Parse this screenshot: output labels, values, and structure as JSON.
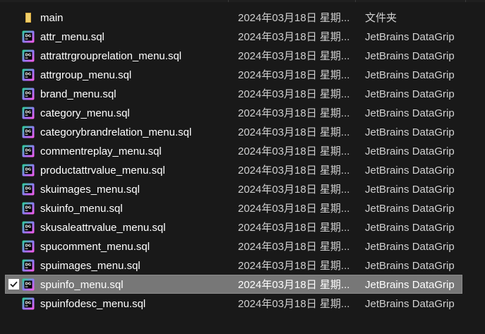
{
  "colors": {
    "background": "#191919",
    "selected_row": "#777777",
    "text_primary": "#ffffff",
    "text_secondary": "#d0d0d0",
    "folder_icon": "#e8c45a"
  },
  "files": [
    {
      "name": "main",
      "date": "2024年03月18日 星期...",
      "type": "文件夹",
      "icon": "folder-icon",
      "selected": false
    },
    {
      "name": "attr_menu.sql",
      "date": "2024年03月18日 星期...",
      "type": "JetBrains DataGrip",
      "icon": "datagrip-icon",
      "selected": false
    },
    {
      "name": "attrattrgrouprelation_menu.sql",
      "date": "2024年03月18日 星期...",
      "type": "JetBrains DataGrip",
      "icon": "datagrip-icon",
      "selected": false
    },
    {
      "name": "attrgroup_menu.sql",
      "date": "2024年03月18日 星期...",
      "type": "JetBrains DataGrip",
      "icon": "datagrip-icon",
      "selected": false
    },
    {
      "name": "brand_menu.sql",
      "date": "2024年03月18日 星期...",
      "type": "JetBrains DataGrip",
      "icon": "datagrip-icon",
      "selected": false
    },
    {
      "name": "category_menu.sql",
      "date": "2024年03月18日 星期...",
      "type": "JetBrains DataGrip",
      "icon": "datagrip-icon",
      "selected": false
    },
    {
      "name": "categorybrandrelation_menu.sql",
      "date": "2024年03月18日 星期...",
      "type": "JetBrains DataGrip",
      "icon": "datagrip-icon",
      "selected": false
    },
    {
      "name": "commentreplay_menu.sql",
      "date": "2024年03月18日 星期...",
      "type": "JetBrains DataGrip",
      "icon": "datagrip-icon",
      "selected": false
    },
    {
      "name": "productattrvalue_menu.sql",
      "date": "2024年03月18日 星期...",
      "type": "JetBrains DataGrip",
      "icon": "datagrip-icon",
      "selected": false
    },
    {
      "name": "skuimages_menu.sql",
      "date": "2024年03月18日 星期...",
      "type": "JetBrains DataGrip",
      "icon": "datagrip-icon",
      "selected": false
    },
    {
      "name": "skuinfo_menu.sql",
      "date": "2024年03月18日 星期...",
      "type": "JetBrains DataGrip",
      "icon": "datagrip-icon",
      "selected": false
    },
    {
      "name": "skusaleattrvalue_menu.sql",
      "date": "2024年03月18日 星期...",
      "type": "JetBrains DataGrip",
      "icon": "datagrip-icon",
      "selected": false
    },
    {
      "name": "spucomment_menu.sql",
      "date": "2024年03月18日 星期...",
      "type": "JetBrains DataGrip",
      "icon": "datagrip-icon",
      "selected": false
    },
    {
      "name": "spuimages_menu.sql",
      "date": "2024年03月18日 星期...",
      "type": "JetBrains DataGrip",
      "icon": "datagrip-icon",
      "selected": false
    },
    {
      "name": "spuinfo_menu.sql",
      "date": "2024年03月18日 星期...",
      "type": "JetBrains DataGrip",
      "icon": "datagrip-icon",
      "selected": true
    },
    {
      "name": "spuinfodesc_menu.sql",
      "date": "2024年03月18日 星期...",
      "type": "JetBrains DataGrip",
      "icon": "datagrip-icon",
      "selected": false
    }
  ]
}
